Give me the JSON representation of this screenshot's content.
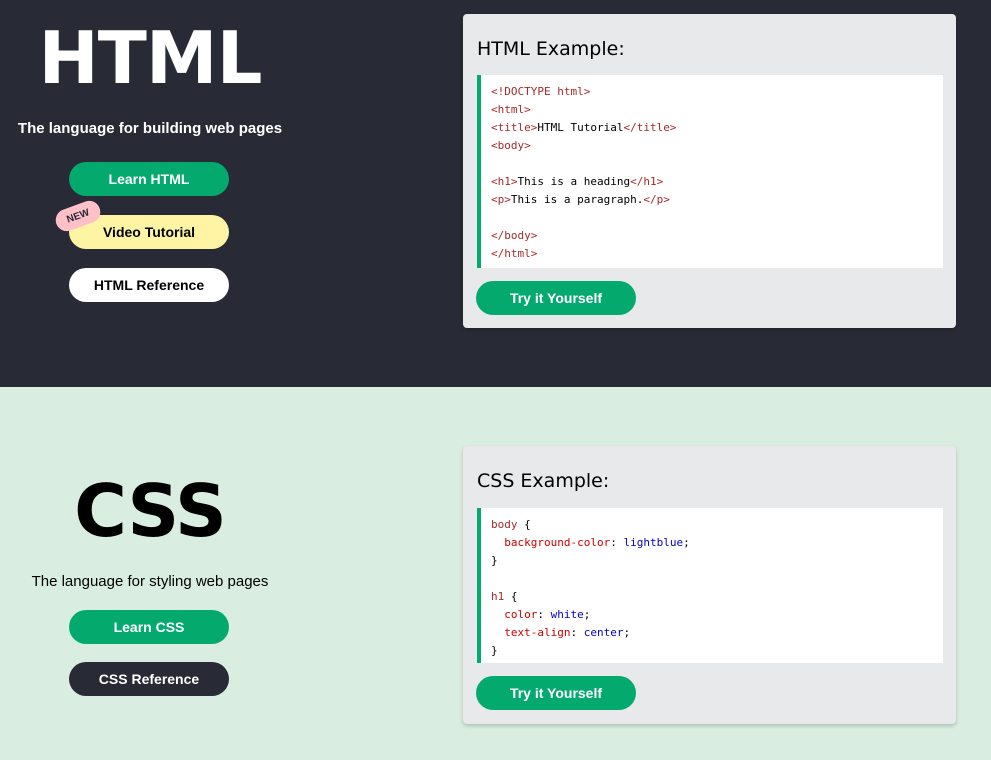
{
  "html_section": {
    "title": "HTML",
    "subtitle": "The language for building web pages",
    "buttons": {
      "learn": "Learn HTML",
      "video": "Video Tutorial",
      "reference": "HTML Reference"
    },
    "new_badge": "NEW",
    "example": {
      "title": "HTML Example:",
      "code_lines": [
        [
          {
            "t": "tag",
            "s": "<!DOCTYPE html>"
          }
        ],
        [
          {
            "t": "tag",
            "s": "<html>"
          }
        ],
        [
          {
            "t": "tag",
            "s": "<title>"
          },
          {
            "t": "txt",
            "s": "HTML Tutorial"
          },
          {
            "t": "tag",
            "s": "</title>"
          }
        ],
        [
          {
            "t": "tag",
            "s": "<body>"
          }
        ],
        [],
        [
          {
            "t": "tag",
            "s": "<h1>"
          },
          {
            "t": "txt",
            "s": "This is a heading"
          },
          {
            "t": "tag",
            "s": "</h1>"
          }
        ],
        [
          {
            "t": "tag",
            "s": "<p>"
          },
          {
            "t": "txt",
            "s": "This is a paragraph."
          },
          {
            "t": "tag",
            "s": "</p>"
          }
        ],
        [],
        [
          {
            "t": "tag",
            "s": "</body>"
          }
        ],
        [
          {
            "t": "tag",
            "s": "</html>"
          }
        ]
      ],
      "try_button": "Try it Yourself"
    }
  },
  "css_section": {
    "title": "CSS",
    "subtitle": "The language for styling web pages",
    "buttons": {
      "learn": "Learn CSS",
      "reference": "CSS Reference"
    },
    "example": {
      "title": "CSS Example:",
      "code_lines": [
        [
          {
            "t": "tag",
            "s": "body"
          },
          {
            "t": "txt",
            "s": " {"
          }
        ],
        [
          {
            "t": "txt",
            "s": "  "
          },
          {
            "t": "prop",
            "s": "background-color"
          },
          {
            "t": "txt",
            "s": ": "
          },
          {
            "t": "val",
            "s": "lightblue"
          },
          {
            "t": "txt",
            "s": ";"
          }
        ],
        [
          {
            "t": "txt",
            "s": "}"
          }
        ],
        [],
        [
          {
            "t": "tag",
            "s": "h1"
          },
          {
            "t": "txt",
            "s": " {"
          }
        ],
        [
          {
            "t": "txt",
            "s": "  "
          },
          {
            "t": "prop",
            "s": "color"
          },
          {
            "t": "txt",
            "s": ": "
          },
          {
            "t": "val",
            "s": "white"
          },
          {
            "t": "txt",
            "s": ";"
          }
        ],
        [
          {
            "t": "txt",
            "s": "  "
          },
          {
            "t": "prop",
            "s": "text-align"
          },
          {
            "t": "txt",
            "s": ": "
          },
          {
            "t": "val",
            "s": "center"
          },
          {
            "t": "txt",
            "s": ";"
          }
        ],
        [
          {
            "t": "txt",
            "s": "}"
          }
        ]
      ],
      "try_button": "Try it Yourself"
    }
  },
  "colors": {
    "dark_bg": "#282a35",
    "light_bg": "#d9eee1",
    "accent_green": "#04aa6d",
    "video_yellow": "#fff4a3",
    "badge_pink": "#ffc0c7"
  }
}
